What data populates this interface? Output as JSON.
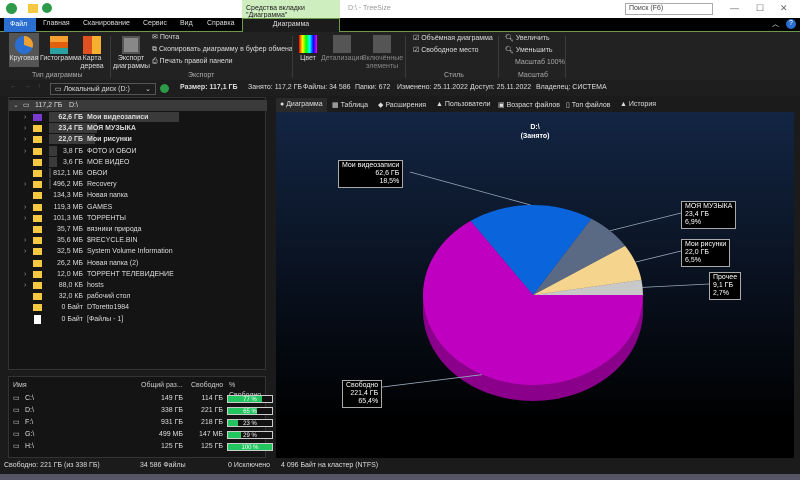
{
  "titlebar": {
    "context_tab": "Средства вкладки \"Диаграмма\"",
    "title": "D:\\ - TreeSize",
    "search_placeholder": "Поиск (F6)"
  },
  "tabs": {
    "file": "Файл",
    "home": "Главная",
    "scan": "Сканирование",
    "service": "Сервис",
    "view": "Вид",
    "help": "Справка",
    "chart": "Диаграмма"
  },
  "ribbon": {
    "pie": "Круговая",
    "histogram": "Гистограмма",
    "treemap": "Карта дерева",
    "group_chart_type": "Тип диаграммы",
    "export_chart": "Экспорт диаграммы",
    "mail": "Почта",
    "copy_chart": "Скопировать диаграмму в буфер обмена",
    "print_right": "Печать правой панели",
    "group_export": "Экспорт",
    "color": "Цвет",
    "detail": "Детализация",
    "included": "Включённые элементы",
    "volume_chart": "Объёмная диаграмма",
    "free_space": "Свободное место",
    "group_style": "Стиль",
    "zoom_in": "Увеличить",
    "zoom_out": "Уменьшить",
    "scale": "Масштаб 100%",
    "group_scale": "Масштаб"
  },
  "address": {
    "drive": "Локальный диск (D:)",
    "size": "Размер: 117,1 ГБ",
    "occupied": "Занято: 117,2 ГБ",
    "files": "Файлы: 34 586",
    "folders": "Папки: 672",
    "modified": "Изменено: 25.11.2022",
    "access": "Доступ: 25.11.2022",
    "owner": "Владелец: СИСТЕМА"
  },
  "tree": {
    "root_size": "117,2 ГБ",
    "root_name": "D:\\",
    "items": [
      {
        "size": "62,6 ГБ",
        "name": "Мои видеозаписи",
        "bold": true,
        "exp": true,
        "pct": 100
      },
      {
        "size": "23,4 ГБ",
        "name": "МОЯ МУЗЫКА",
        "bold": true,
        "exp": true,
        "pct": 37
      },
      {
        "size": "22,0 ГБ",
        "name": "Мои рисунки",
        "bold": true,
        "exp": true,
        "pct": 35
      },
      {
        "size": "3,8 ГБ",
        "name": "ФОТО И ОБОИ",
        "exp": true,
        "pct": 6
      },
      {
        "size": "3,6 ГБ",
        "name": "МОЕ ВИДЕО",
        "pct": 6
      },
      {
        "size": "812,1 МБ",
        "name": "ОБОИ",
        "pct": 1
      },
      {
        "size": "496,2 МБ",
        "name": "Recovery",
        "exp": true,
        "pct": 1
      },
      {
        "size": "134,3 МБ",
        "name": "Новая папка",
        "pct": 0
      },
      {
        "size": "119,3 МБ",
        "name": "GAMES",
        "exp": true,
        "pct": 0
      },
      {
        "size": "101,3 МБ",
        "name": "ТОРРЕНТЫ",
        "exp": true,
        "pct": 0
      },
      {
        "size": "35,7 МБ",
        "name": "вязники природа",
        "pct": 0
      },
      {
        "size": "35,6 МБ",
        "name": "$RECYCLE.BIN",
        "exp": true,
        "pct": 0
      },
      {
        "size": "32,5 МБ",
        "name": "System Volume Information",
        "exp": true,
        "pct": 0
      },
      {
        "size": "26,2 МБ",
        "name": "Новая папка (2)",
        "pct": 0
      },
      {
        "size": "12,0 МБ",
        "name": "ТОРРЕНТ ТЕЛЕВИДЕНИЕ",
        "exp": true,
        "pct": 0
      },
      {
        "size": "88,0 КБ",
        "name": "hosts",
        "exp": true,
        "pct": 0
      },
      {
        "size": "32,0 КБ",
        "name": "рабочий стол",
        "pct": 0
      },
      {
        "size": "0 Байт",
        "name": "DToretto1984",
        "pct": 0
      },
      {
        "size": "0 Байт",
        "name": "[Файлы - 1]",
        "file": true,
        "pct": 0
      }
    ]
  },
  "drives": {
    "headers": [
      "Имя",
      "Общий раз...",
      "Свободно",
      "% Свободно"
    ],
    "rows": [
      {
        "name": "C:\\",
        "total": "149 ГБ",
        "free": "114 ГБ",
        "pct": 77,
        "pct_label": "77 %"
      },
      {
        "name": "D:\\",
        "total": "338 ГБ",
        "free": "221 ГБ",
        "pct": 65,
        "pct_label": "65 %"
      },
      {
        "name": "F:\\",
        "total": "931 ГБ",
        "free": "218 ГБ",
        "pct": 23,
        "pct_label": "23 %"
      },
      {
        "name": "G:\\",
        "total": "499 МБ",
        "free": "147 МБ",
        "pct": 29,
        "pct_label": "29 %"
      },
      {
        "name": "H:\\",
        "total": "125 ГБ",
        "free": "125 ГБ",
        "pct": 100,
        "pct_label": "100 %"
      }
    ]
  },
  "status": {
    "free": "Свободно: 221 ГБ  (из 338 ГБ)",
    "files": "34 586 Файлы",
    "excluded": "0 Исключено",
    "cluster": "4 096 Байт на кластер (NTFS)"
  },
  "right_tabs": [
    "Диаграмма",
    "Таблица",
    "Расширения",
    "Пользователи",
    "Возраст файлов",
    "Топ файлов",
    "История"
  ],
  "chart_data": {
    "type": "pie",
    "title": "D:\\",
    "subtitle": "(Занято)",
    "slices": [
      {
        "name": "Прочее",
        "size": "9,1 ГБ",
        "pct_label": "2,7%",
        "value": 2.7,
        "color": "#c8c8c8"
      },
      {
        "name": "Мои рисунки",
        "size": "22,0 ГБ",
        "pct_label": "6,5%",
        "value": 6.5,
        "color": "#f5d48e"
      },
      {
        "name": "МОЯ МУЗЫКА",
        "size": "23,4 ГБ",
        "pct_label": "6,9%",
        "value": 6.9,
        "color": "#5a6a85"
      },
      {
        "name": "Мои видеозаписи",
        "size": "62,6 ГБ",
        "pct_label": "18,5%",
        "value": 18.5,
        "color": "#0a64dc"
      },
      {
        "name": "Свободно",
        "size": "221,4 ГБ",
        "pct_label": "65,4%",
        "value": 65.4,
        "color": "#c000c0"
      }
    ]
  }
}
